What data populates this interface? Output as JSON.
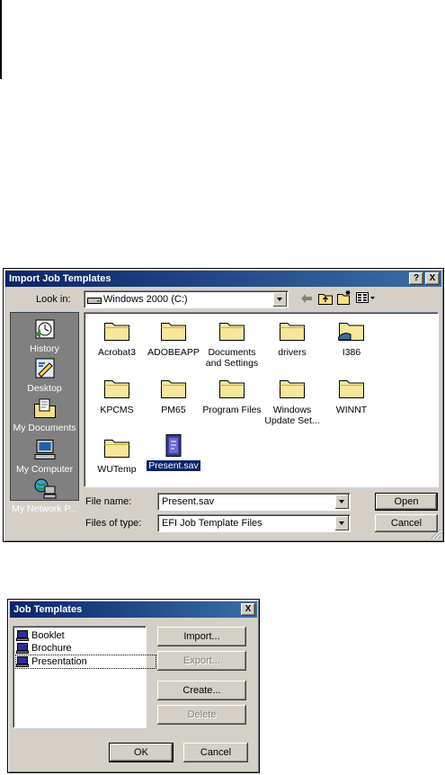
{
  "import_dialog": {
    "title": "Import Job Templates",
    "help_label": "?",
    "close_label": "X",
    "look_in_label": "Look in:",
    "look_in_value": "Windows 2000 (C:)",
    "places": [
      {
        "label": "History",
        "icon": "history-icon"
      },
      {
        "label": "Desktop",
        "icon": "desktop-icon"
      },
      {
        "label": "My Documents",
        "icon": "my-documents-icon"
      },
      {
        "label": "My Computer",
        "icon": "my-computer-icon"
      },
      {
        "label": "My Network P...",
        "icon": "my-network-places-icon"
      }
    ],
    "files": [
      {
        "name": "Acrobat3",
        "type": "folder"
      },
      {
        "name": "ADOBEAPP",
        "type": "folder"
      },
      {
        "name": "Documents and Settings",
        "type": "folder"
      },
      {
        "name": "drivers",
        "type": "folder"
      },
      {
        "name": "I386",
        "type": "folder"
      },
      {
        "name": "KPCMS",
        "type": "folder"
      },
      {
        "name": "PM65",
        "type": "folder"
      },
      {
        "name": "Program Files",
        "type": "folder"
      },
      {
        "name": "Windows Update Set...",
        "type": "folder"
      },
      {
        "name": "WINNT",
        "type": "folder"
      },
      {
        "name": "WUTemp",
        "type": "folder"
      },
      {
        "name": "Present.sav",
        "type": "file",
        "selected": true
      }
    ],
    "file_name_label": "File name:",
    "file_name_value": "Present.sav",
    "files_of_type_label": "Files of type:",
    "files_of_type_value": "EFI Job Template Files",
    "open_label": "Open",
    "cancel_label": "Cancel"
  },
  "templates_dialog": {
    "title": "Job Templates",
    "close_label": "X",
    "items": [
      "Booklet",
      "Brochure",
      "Presentation"
    ],
    "import_label": "Import...",
    "export_label": "Export...",
    "create_label": "Create...",
    "delete_label": "Delete",
    "ok_label": "OK",
    "cancel_label": "Cancel"
  }
}
